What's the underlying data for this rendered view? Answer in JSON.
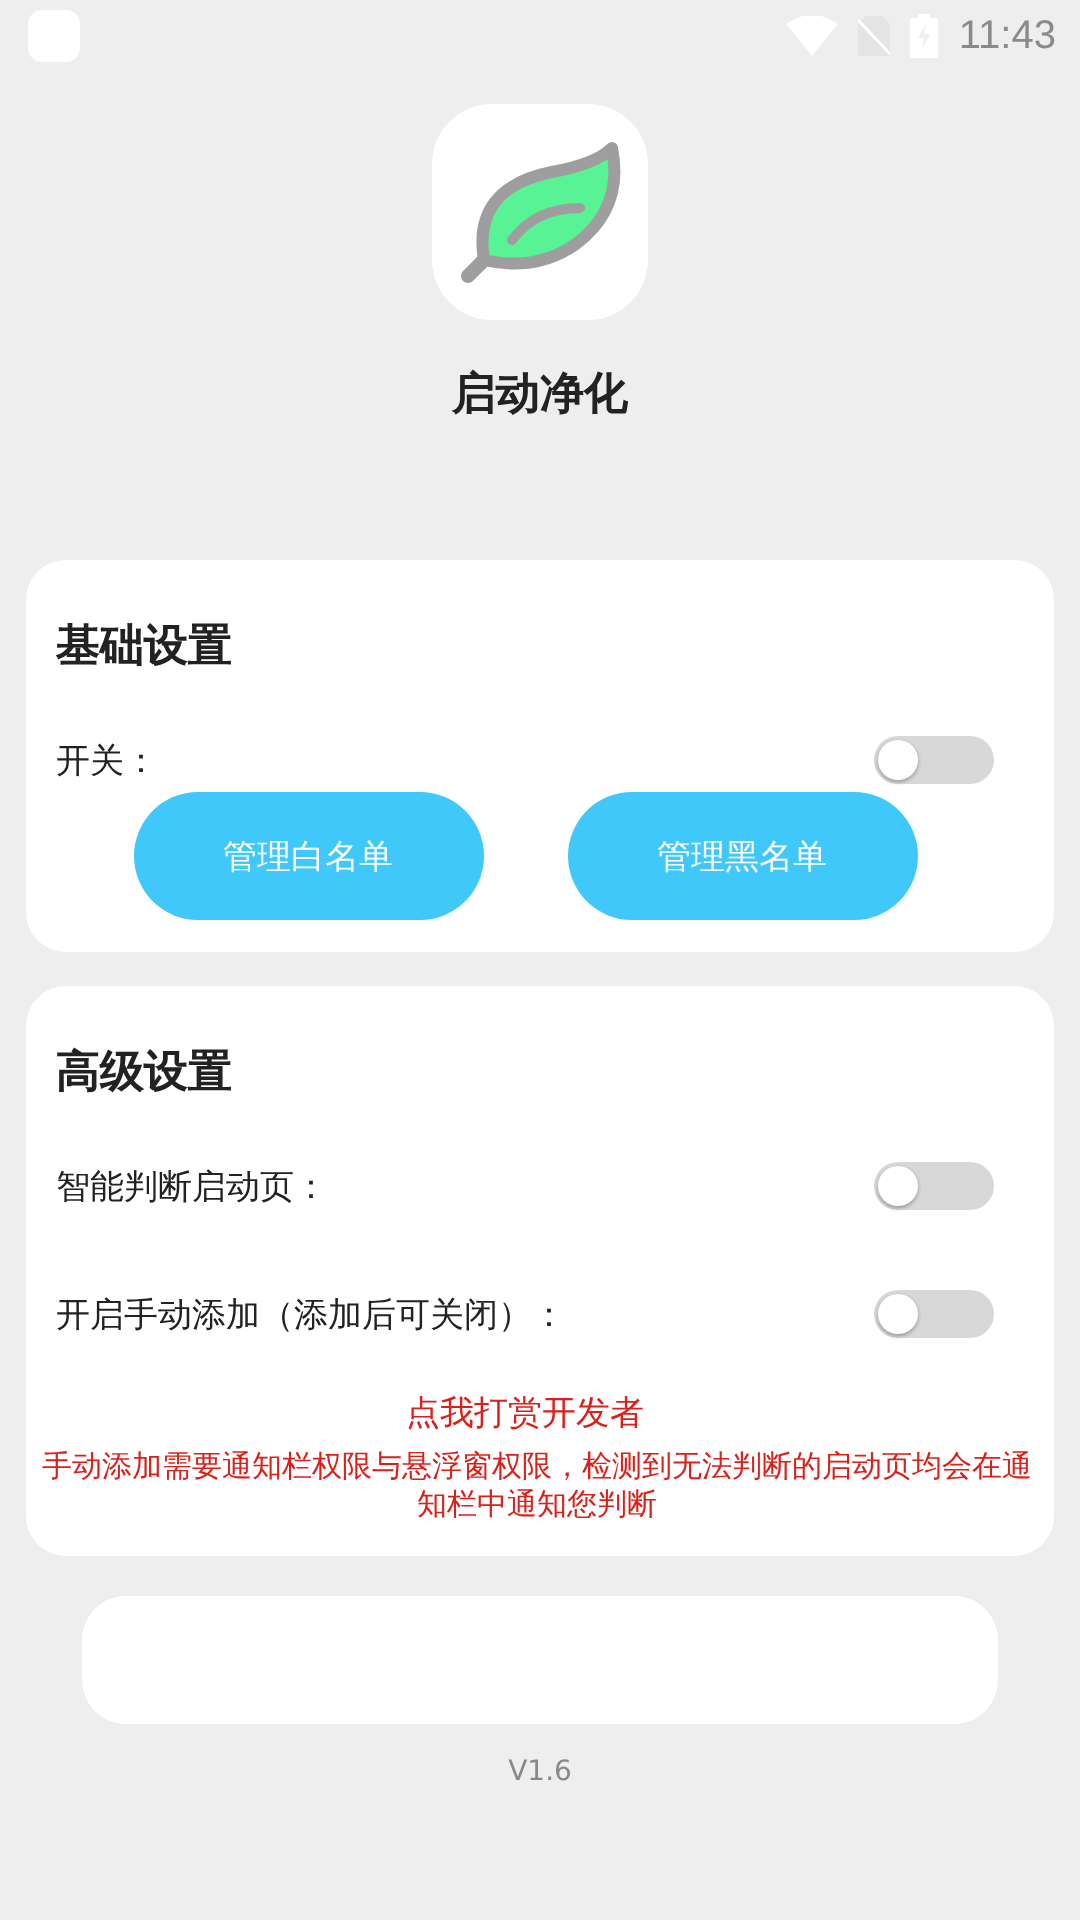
{
  "status_bar": {
    "time": "11:43"
  },
  "app": {
    "title": "启动净化"
  },
  "basic": {
    "title": "基础设置",
    "switches": [
      {
        "label": "开关：",
        "on": false
      }
    ],
    "buttons": [
      "管理白名单",
      "管理黑名单"
    ]
  },
  "advanced": {
    "title": "高级设置",
    "switches": [
      {
        "label": "智能判断启动页：",
        "on": false
      },
      {
        "label": "开启手动添加（添加后可关闭）：",
        "on": false
      }
    ],
    "donate": "点我打赏开发者",
    "notice": "手动添加需要通知栏权限与悬浮窗权限，检测到无法判断的启动页均会在通知栏中通知您判断"
  },
  "version": "V1.6"
}
